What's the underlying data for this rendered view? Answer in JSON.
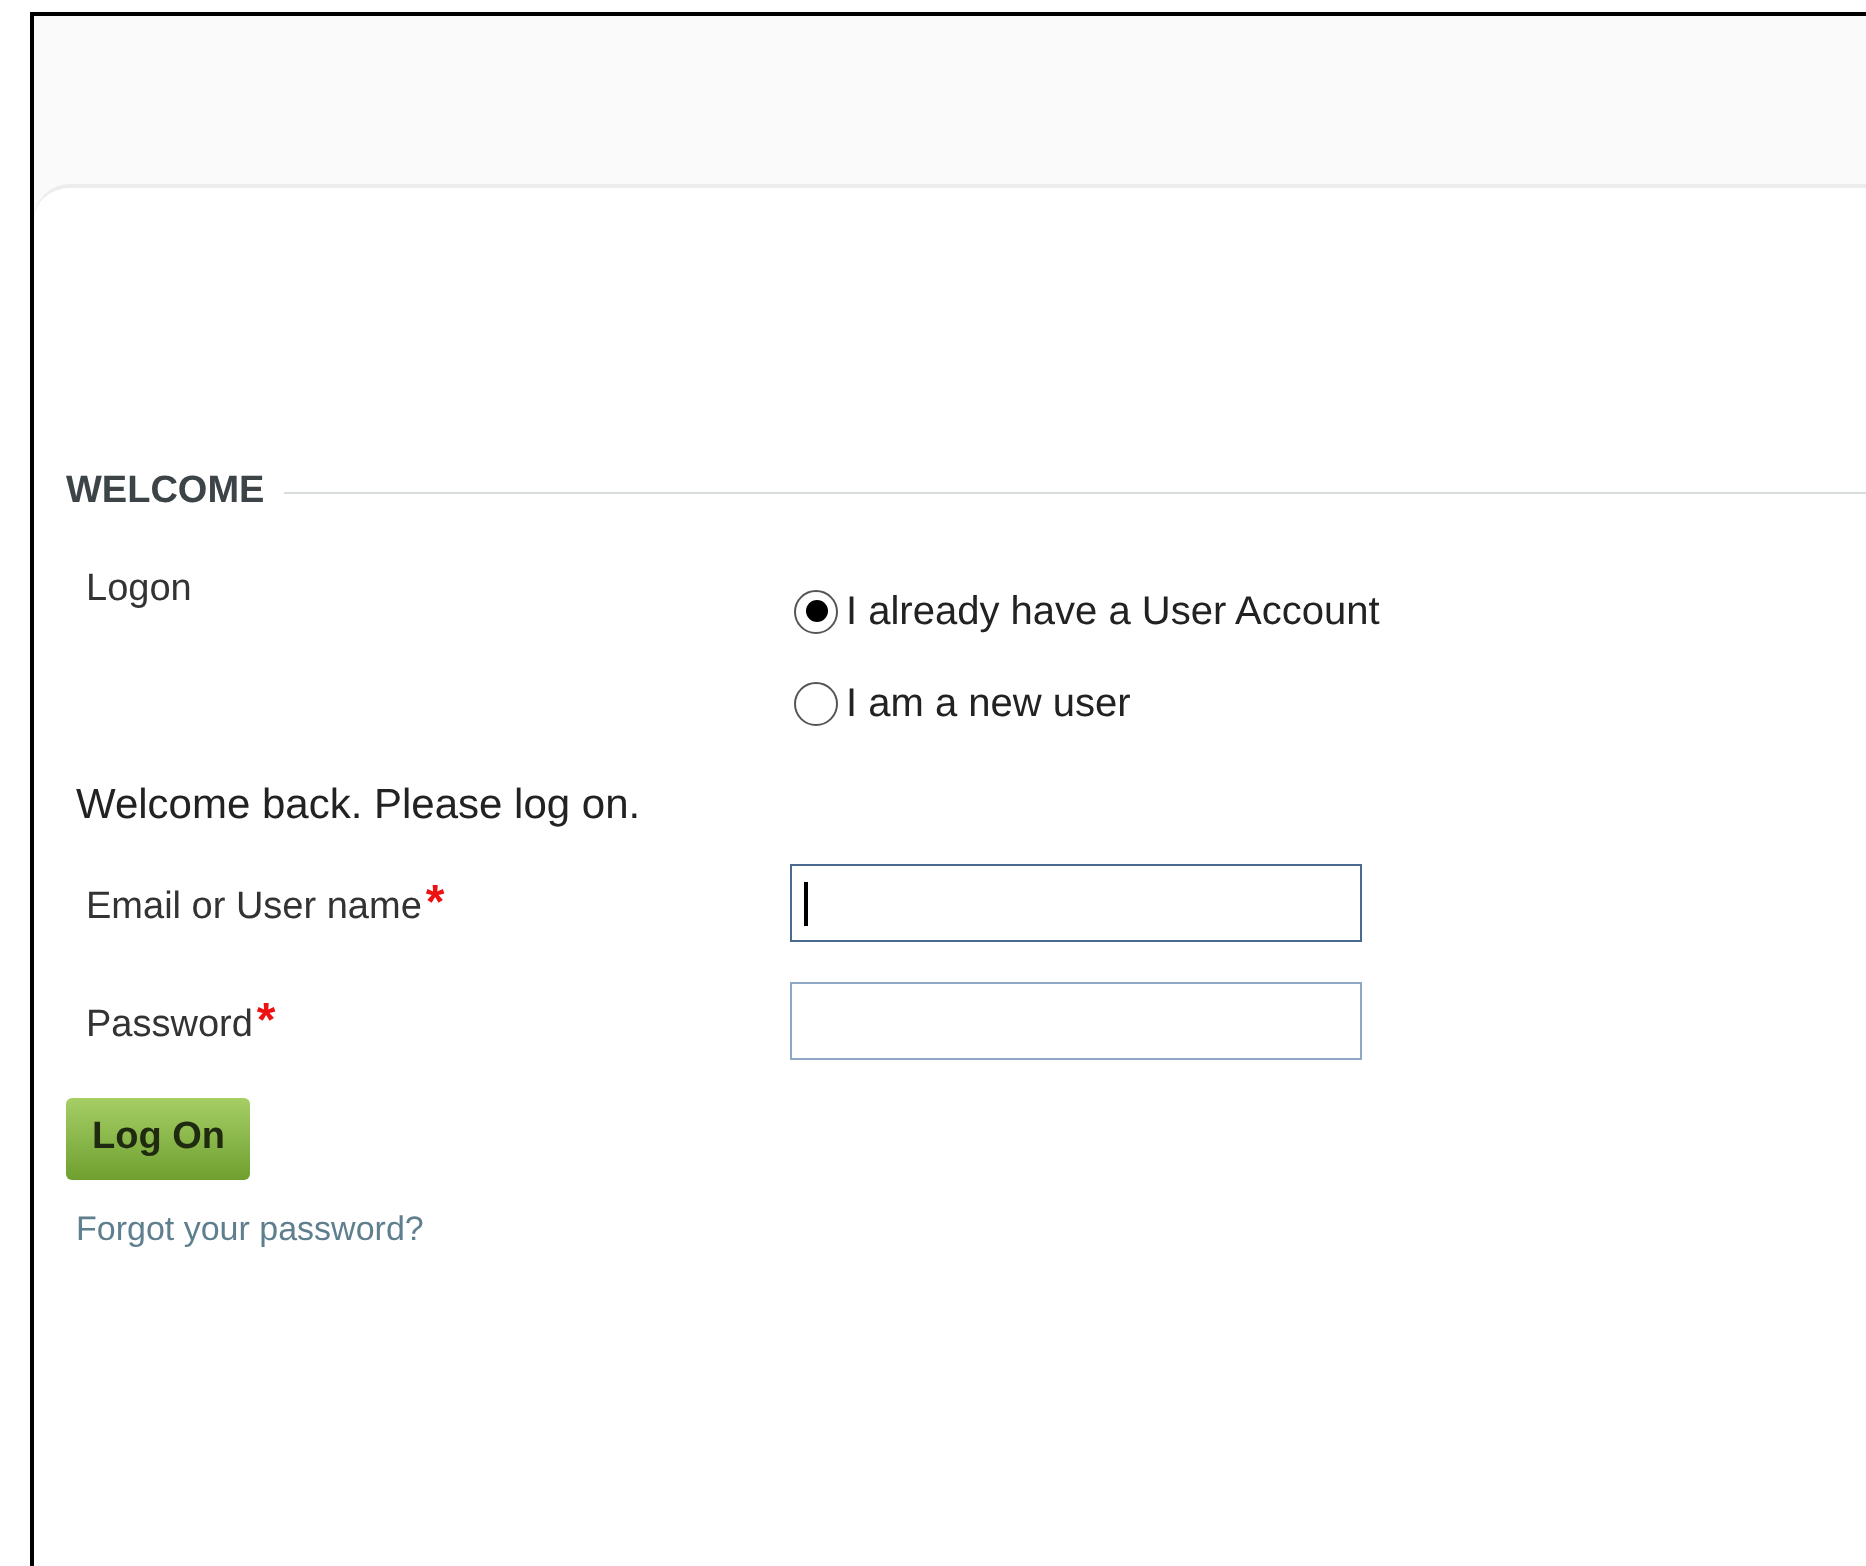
{
  "section": {
    "title": "WELCOME"
  },
  "logon": {
    "label": "Logon",
    "options": [
      {
        "label": "I already have a User Account",
        "selected": true
      },
      {
        "label": "I am a new user",
        "selected": false
      }
    ]
  },
  "intro": "Welcome back. Please log on.",
  "fields": [
    {
      "label": "Email or User name",
      "required_mark": "*",
      "focused": true
    },
    {
      "label": "Password",
      "required_mark": "*",
      "focused": false
    }
  ],
  "submit": "Log On",
  "forgot_link": "Forgot your password?"
}
